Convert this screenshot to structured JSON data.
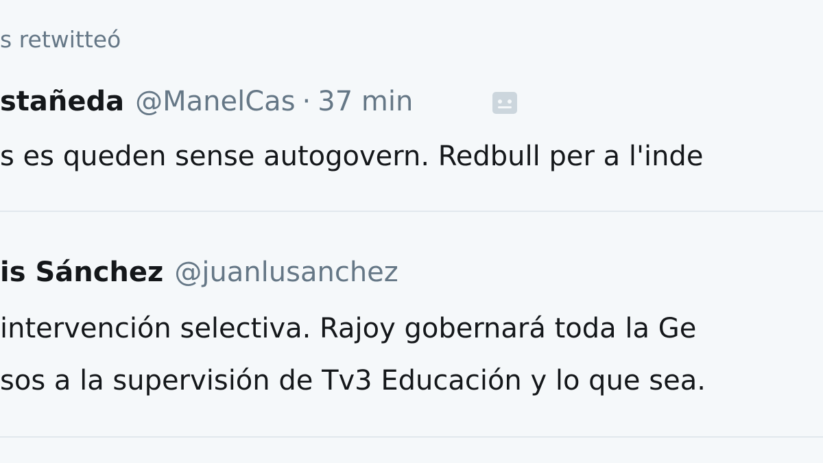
{
  "retweet_context": {
    "text": "s retwitteó"
  },
  "tweets": [
    {
      "name": "stañeda",
      "handle": "@ManelCas",
      "separator": "·",
      "time": "37 min",
      "icon": "message-icon",
      "text_lines": [
        "s es queden sense autogovern. Redbull per a l'inde"
      ]
    },
    {
      "name": "is Sánchez",
      "handle": "@juanlusanchez",
      "text_lines": [
        " intervención selectiva. Rajoy gobernará toda la Ge",
        "sos a la supervisión de Tv3 Educación y lo que sea."
      ]
    }
  ],
  "colors": {
    "background": "#f5f8fa",
    "text": "#14171a",
    "secondary": "#657786",
    "divider": "#e1e8ed"
  }
}
